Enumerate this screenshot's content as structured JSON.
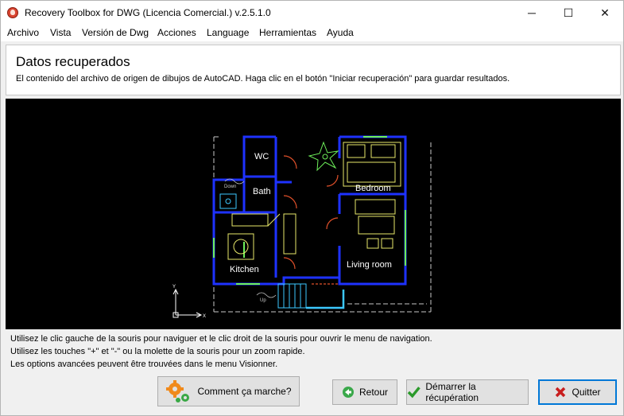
{
  "window": {
    "title": "Recovery Toolbox for DWG (Licencia Comercial.) v.2.5.1.0",
    "minimize_glyph": "─",
    "maximize_glyph": "☐",
    "close_glyph": "✕"
  },
  "menu": {
    "items": [
      {
        "label": "Archivo"
      },
      {
        "label": "Vista"
      },
      {
        "label": "Versión de Dwg"
      },
      {
        "label": "Acciones"
      },
      {
        "label": "Language"
      },
      {
        "label": "Herramientas"
      },
      {
        "label": "Ayuda"
      }
    ]
  },
  "header": {
    "title": "Datos recuperados",
    "subtitle": "El contenido del archivo de origen de dibujos de AutoCAD. Haga clic en el botón \"Iniciar recuperación\" para guardar resultados."
  },
  "drawing": {
    "rooms": {
      "wc": "WC",
      "bath": "Bath",
      "bedroom": "Bedroom",
      "kitchen": "Kitchen",
      "living": "Living room",
      "down": "Down",
      "up": "Up"
    },
    "axes": {
      "y": "Y",
      "x": "X"
    },
    "colors": {
      "wall": "#1e32ff",
      "fixture": "#e8e86a",
      "window": "#6ef05a",
      "door": "#e0502a",
      "dash": "#c8c8c8",
      "stair": "#3cc8ff"
    }
  },
  "hints": {
    "line1": "Utilisez le clic gauche de la souris pour naviguer et le clic droit de la souris pour ouvrir le menu de navigation.",
    "line2": "Utilisez les touches \"+\" et \"-\" ou la molette de la souris pour un zoom rapide.",
    "line3": "Les options avancées peuvent être trouvées dans le menu Visionner."
  },
  "buttons": {
    "how": "Comment ça marche?",
    "back": "Retour",
    "start": "Démarrer la récupération",
    "quit": "Quitter"
  }
}
